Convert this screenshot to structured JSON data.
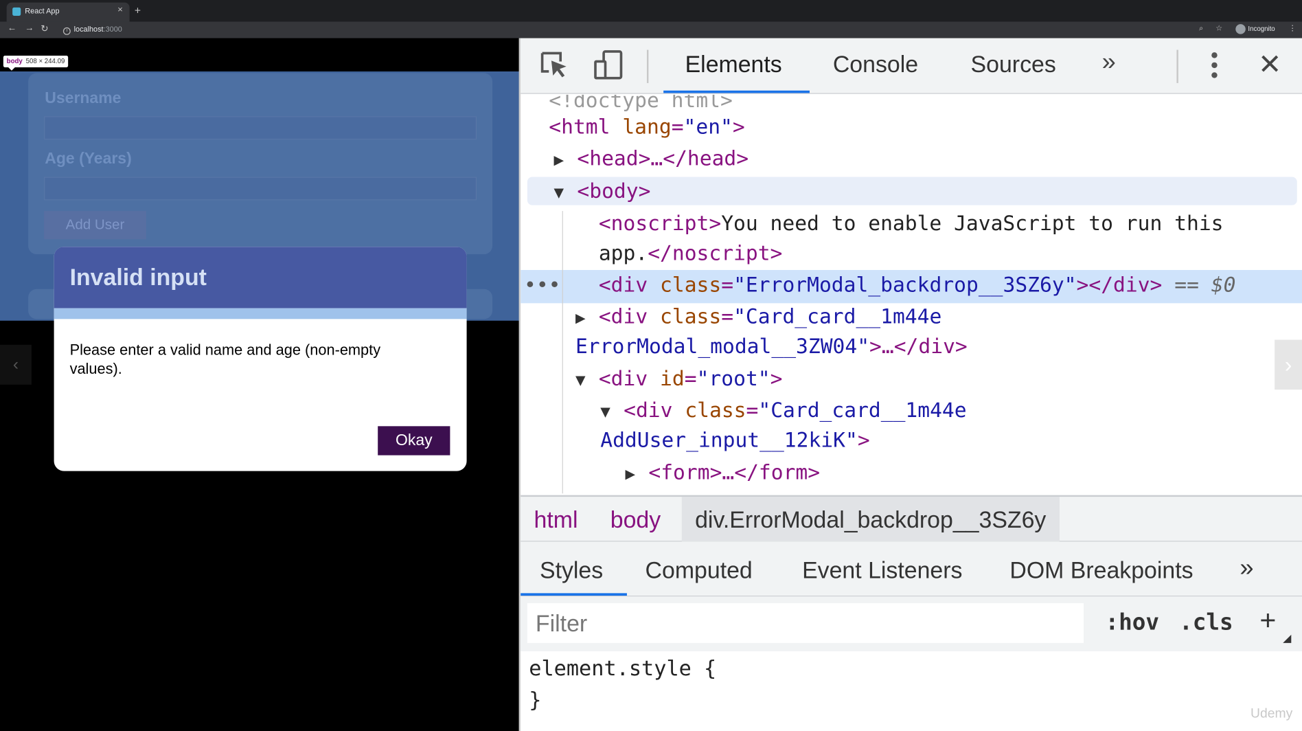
{
  "browser": {
    "tab_title": "React App",
    "tab_close": "×",
    "new_tab": "+",
    "url_host": "localhost",
    "url_port": ":3000",
    "profile_label": "Incognito"
  },
  "page": {
    "inspect_tooltip": {
      "tag": "body",
      "size": "508 × 244.09"
    },
    "form": {
      "username_label": "Username",
      "age_label": "Age (Years)",
      "submit_label": "Add User"
    },
    "modal": {
      "title": "Invalid input",
      "message": "Please enter a valid name and age (non-empty values).",
      "ok_label": "Okay"
    }
  },
  "devtools": {
    "tabs": [
      "Elements",
      "Console",
      "Sources"
    ],
    "active_tab": "Elements",
    "dom": {
      "doctype": "<!doctype html>",
      "html_open": "<html",
      "html_lang_attr": "lang",
      "html_lang_val": "\"en\"",
      "head": "<head>…</head>",
      "body_open": "<body>",
      "noscript_open": "<noscript>",
      "noscript_text_1": "You need to enable JavaScript to run this",
      "noscript_text_2": "app.",
      "noscript_close": "</noscript>",
      "backdrop_class": "\"ErrorModal_backdrop__3SZ6y\"",
      "selected_marker": "== $0",
      "modal_class_1": "\"Card_card__1m44e",
      "modal_class_2": "ErrorModal_modal__3ZW04\"",
      "root_id": "\"root\"",
      "card_class_1": "\"Card_card__1m44e",
      "card_class_2": "AddUser_input__12kiK\"",
      "form": "<form>…</form>"
    },
    "breadcrumbs": [
      "html",
      "body",
      "div.ErrorModal_backdrop__3SZ6y"
    ],
    "styles_tabs": [
      "Styles",
      "Computed",
      "Event Listeners",
      "DOM Breakpoints"
    ],
    "active_styles_tab": "Styles",
    "filter_placeholder": "Filter",
    "hov_label": ":hov",
    "cls_label": ".cls",
    "rule_selector": "element.style {",
    "rule_close": "}"
  },
  "watermark": "Udemy",
  "colors": {
    "tag": "#881280",
    "attr": "#994500",
    "value": "#1a1aa6",
    "accent": "#1a73e8",
    "modal_header": "#4759a2",
    "ok_button": "#3c0f4f"
  }
}
